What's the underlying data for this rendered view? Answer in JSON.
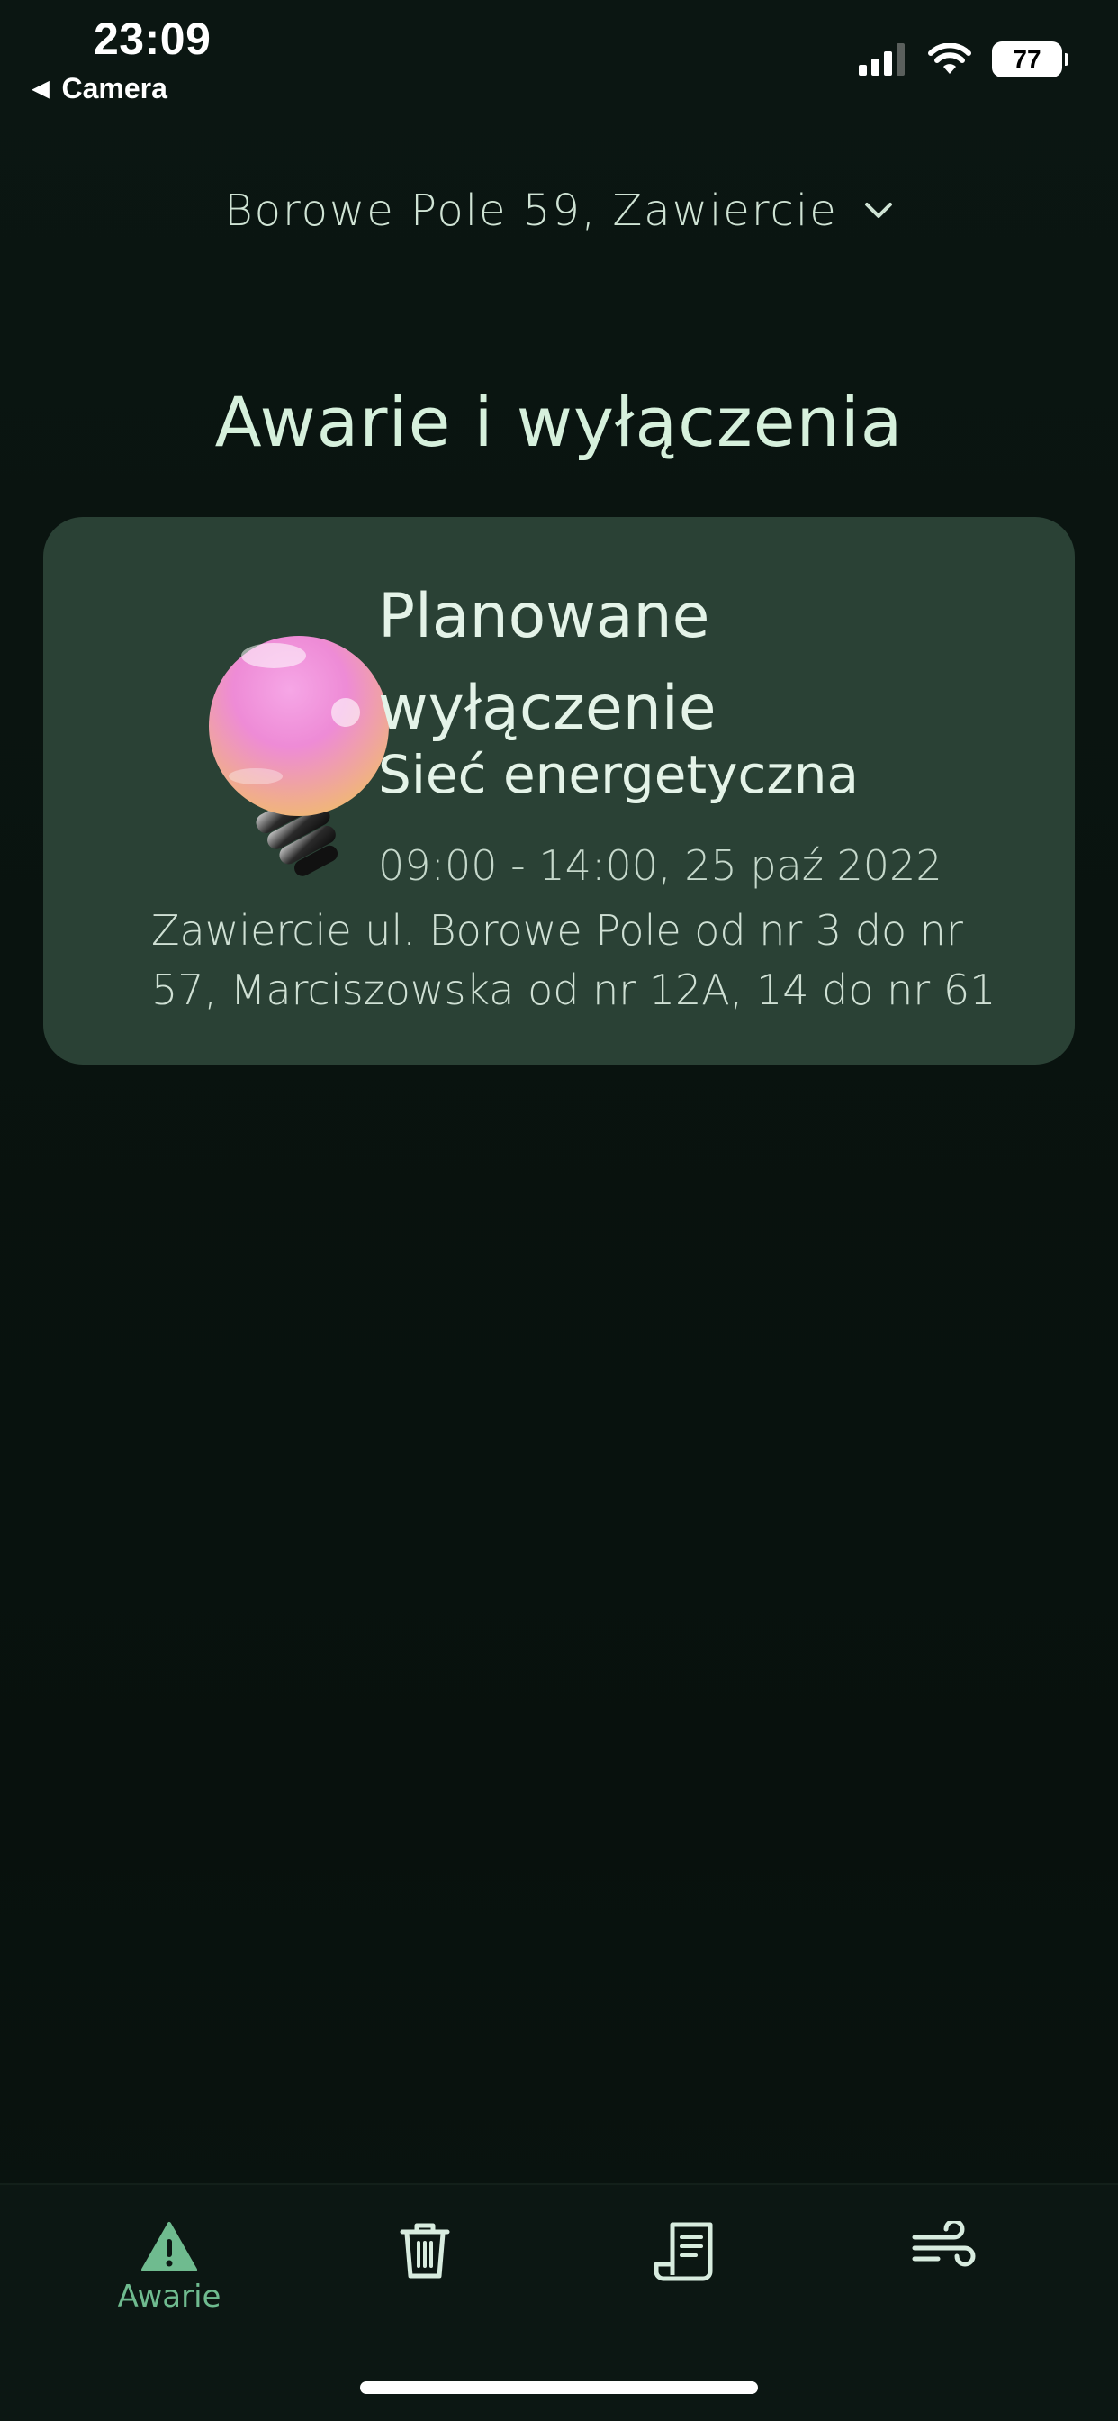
{
  "status_bar": {
    "time": "23:09",
    "back_label": "Camera",
    "battery": "77"
  },
  "header": {
    "location": "Borowe Pole 59, Zawiercie"
  },
  "page": {
    "title": "Awarie i wyłączenia"
  },
  "outage_card": {
    "title": "Planowane wyłączenie",
    "subtitle": "Sieć energetyczna",
    "time_range": "09:00 - 14:00, 25 paź 2022",
    "description": "Zawiercie ul. Borowe Pole od nr 3 do nr 57, Marciszowska od nr 12A, 14 do nr 61"
  },
  "tabbar": {
    "tabs": [
      {
        "label": "Awarie",
        "icon": "warning-icon",
        "active": true
      },
      {
        "label": "",
        "icon": "trash-icon",
        "active": false
      },
      {
        "label": "",
        "icon": "receipt-icon",
        "active": false
      },
      {
        "label": "",
        "icon": "wind-icon",
        "active": false
      }
    ]
  },
  "colors": {
    "background": "#0a1411",
    "card": "#2a4135",
    "accent": "#6fbb8f",
    "text": "#d8ecdf"
  }
}
